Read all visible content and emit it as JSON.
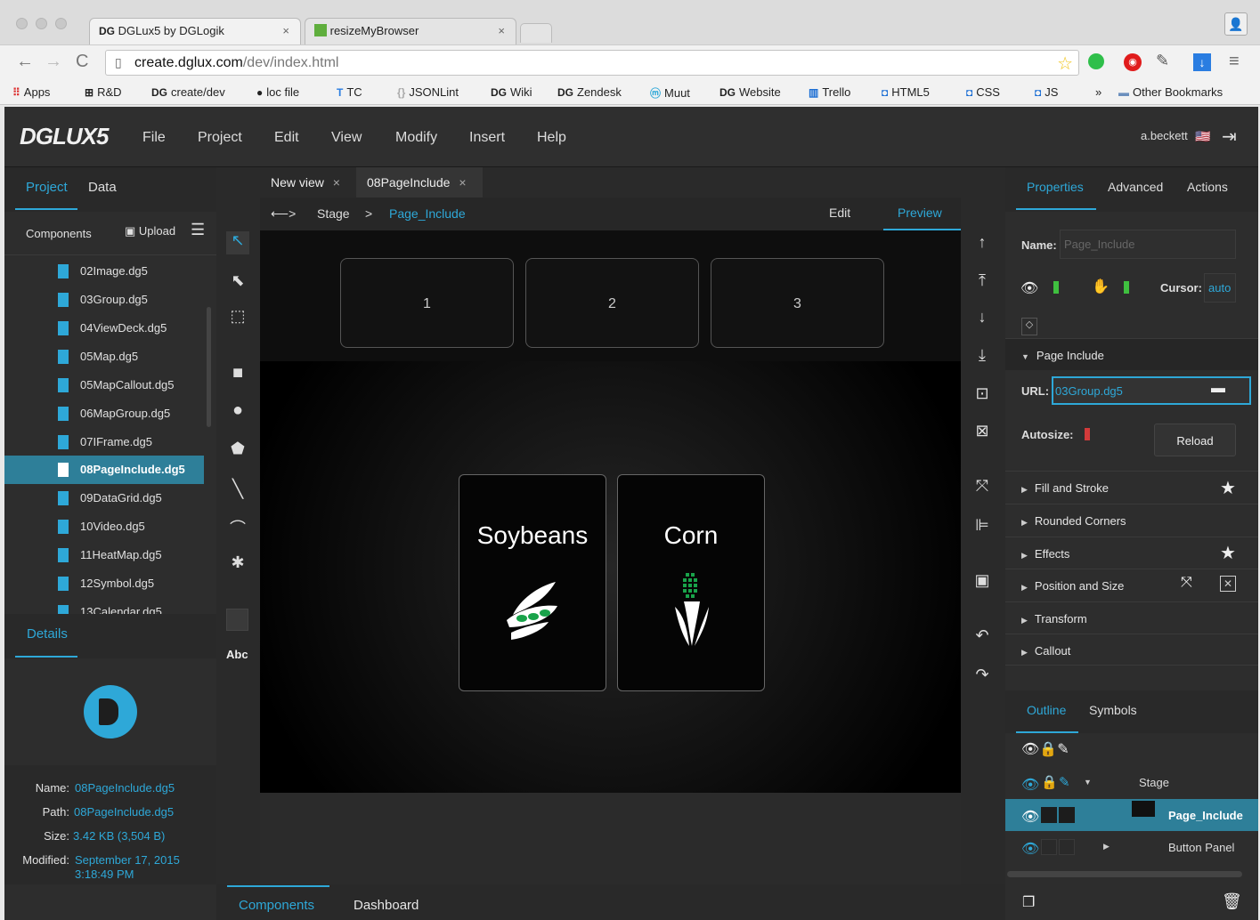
{
  "browser": {
    "tabs": [
      {
        "label": "DGLux5 by DGLogik",
        "icon": "dg-logo-icon"
      },
      {
        "label": "resizeMyBrowser",
        "icon": "resize-icon"
      }
    ],
    "url_host": "create.dglux.com",
    "url_path": "/dev/index.html",
    "bookmarks": [
      {
        "label": "Apps",
        "icon": "apps-grid-icon"
      },
      {
        "label": "R&D",
        "icon": "rnd-icon"
      },
      {
        "label": "create/dev",
        "icon": "dg-logo-icon"
      },
      {
        "label": "loc file",
        "icon": "github-icon"
      },
      {
        "label": "TC",
        "icon": "teamcity-icon"
      },
      {
        "label": "JSONLint",
        "icon": "braces-icon"
      },
      {
        "label": "Wiki",
        "icon": "dg-logo-icon"
      },
      {
        "label": "Zendesk",
        "icon": "dg-logo-icon"
      },
      {
        "label": "Muut",
        "icon": "muut-icon"
      },
      {
        "label": "Website",
        "icon": "dg-logo-icon"
      },
      {
        "label": "Trello",
        "icon": "trello-icon"
      },
      {
        "label": "HTML5",
        "icon": "bookmark-icon"
      },
      {
        "label": "CSS",
        "icon": "bookmark-icon"
      },
      {
        "label": "JS",
        "icon": "bookmark-icon"
      },
      {
        "label": "»",
        "icon": ""
      },
      {
        "label": "Other Bookmarks",
        "icon": "folder-icon"
      }
    ]
  },
  "app": {
    "logo": "DGLUX5",
    "menu": [
      "File",
      "Project",
      "Edit",
      "View",
      "Modify",
      "Insert",
      "Help"
    ],
    "user": "a.beckett"
  },
  "left_panel": {
    "tabs": [
      "Project",
      "Data"
    ],
    "components_label": "Components",
    "upload_label": "Upload",
    "files": [
      "02Image.dg5",
      "03Group.dg5",
      "04ViewDeck.dg5",
      "05Map.dg5",
      "05MapCallout.dg5",
      "06MapGroup.dg5",
      "07IFrame.dg5",
      "08PageInclude.dg5",
      "09DataGrid.dg5",
      "10Video.dg5",
      "11HeatMap.dg5",
      "12Symbol.dg5",
      "13Calendar.dg5"
    ],
    "selected_file": "08PageInclude.dg5",
    "details_tab": "Details",
    "details": {
      "name_label": "Name:",
      "name_value": "08PageInclude.dg5",
      "path_label": "Path:",
      "path_value": "08PageInclude.dg5",
      "size_label": "Size:",
      "size_value": "3.42 KB (3,504 B)",
      "modified_label": "Modified:",
      "modified_value": "September 17, 2015",
      "modified_time": "3:18:49 PM"
    }
  },
  "tools": {
    "text_tool": "Abc"
  },
  "editor": {
    "doc_tabs": [
      "New view",
      "08PageInclude"
    ],
    "breadcrumb": {
      "arrows": "⟵>",
      "stage": "Stage",
      "sep": ">",
      "current": "Page_Include"
    },
    "mode_edit": "Edit",
    "mode_preview": "Preview",
    "top_buttons": [
      "1",
      "2",
      "3"
    ],
    "cards": [
      {
        "title": "Soybeans",
        "icon": "soybean-icon"
      },
      {
        "title": "Corn",
        "icon": "corn-icon"
      }
    ]
  },
  "right_panel": {
    "tabs": [
      "Properties",
      "Advanced",
      "Actions"
    ],
    "name_label": "Name:",
    "name_placeholder": "Page_Include",
    "cursor_label": "Cursor:",
    "cursor_value": "auto",
    "page_include_header": "Page Include",
    "url_label": "URL:",
    "url_value": "03Group.dg5",
    "autosize_label": "Autosize:",
    "reload_label": "Reload",
    "sections": [
      "Fill and Stroke",
      "Rounded Corners",
      "Effects",
      "Position and Size",
      "Transform",
      "Callout"
    ],
    "outline_tabs": [
      "Outline",
      "Symbols"
    ],
    "outline_rows": [
      {
        "label": "Stage"
      },
      {
        "label": "Page_Include"
      },
      {
        "label": "Button Panel"
      }
    ]
  },
  "bottom_tabs": [
    "Components",
    "Dashboard"
  ],
  "colors": {
    "accent": "#2ea8d8",
    "selected_row": "#2e7f99",
    "toggle_green": "#3fbf3f",
    "toggle_red": "#d23a3a"
  }
}
